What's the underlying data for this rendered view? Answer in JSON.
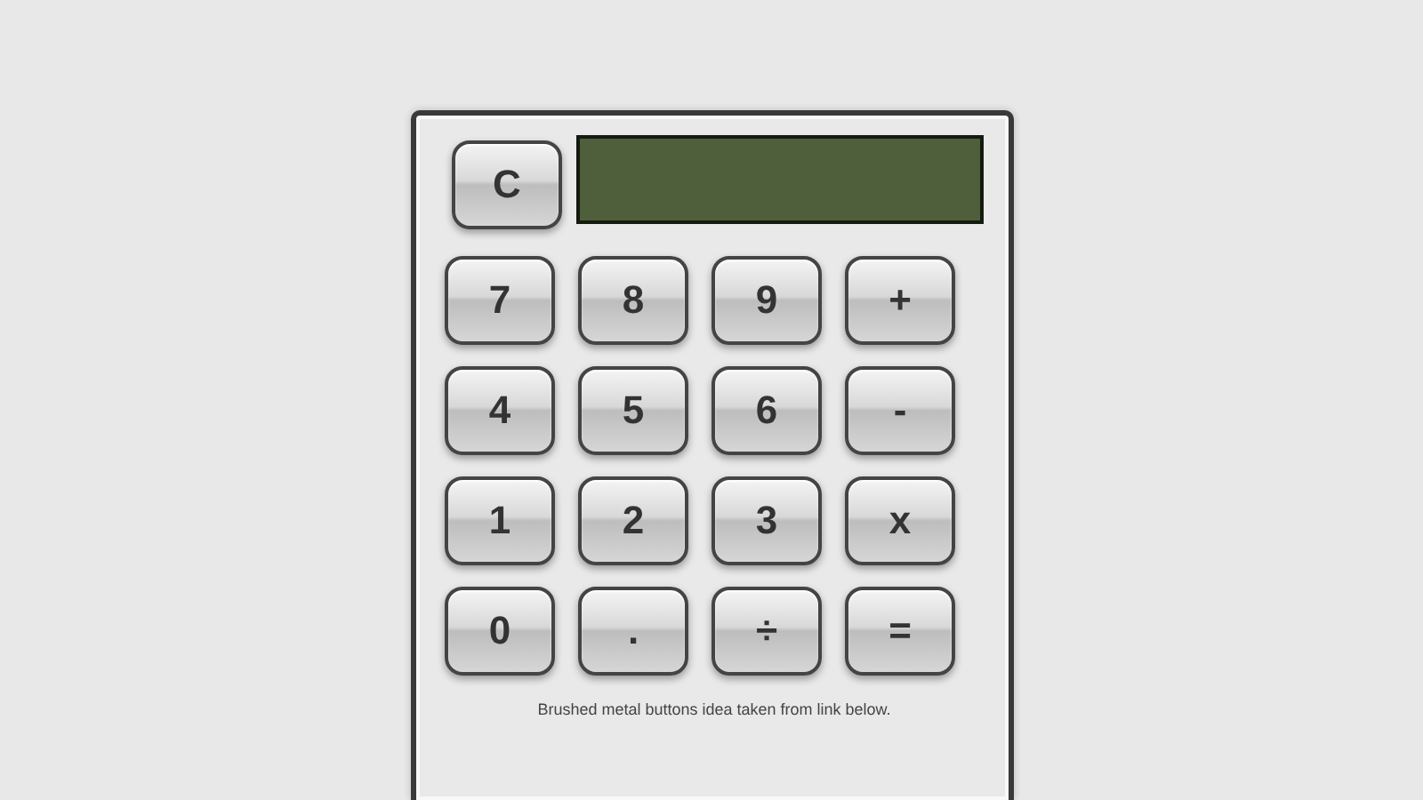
{
  "clear_key": "C",
  "keys": [
    "7",
    "8",
    "9",
    "+",
    "4",
    "5",
    "6",
    "-",
    "1",
    "2",
    "3",
    "x",
    "0",
    ".",
    "÷",
    "="
  ],
  "note": "Brushed metal buttons idea taken from link below."
}
